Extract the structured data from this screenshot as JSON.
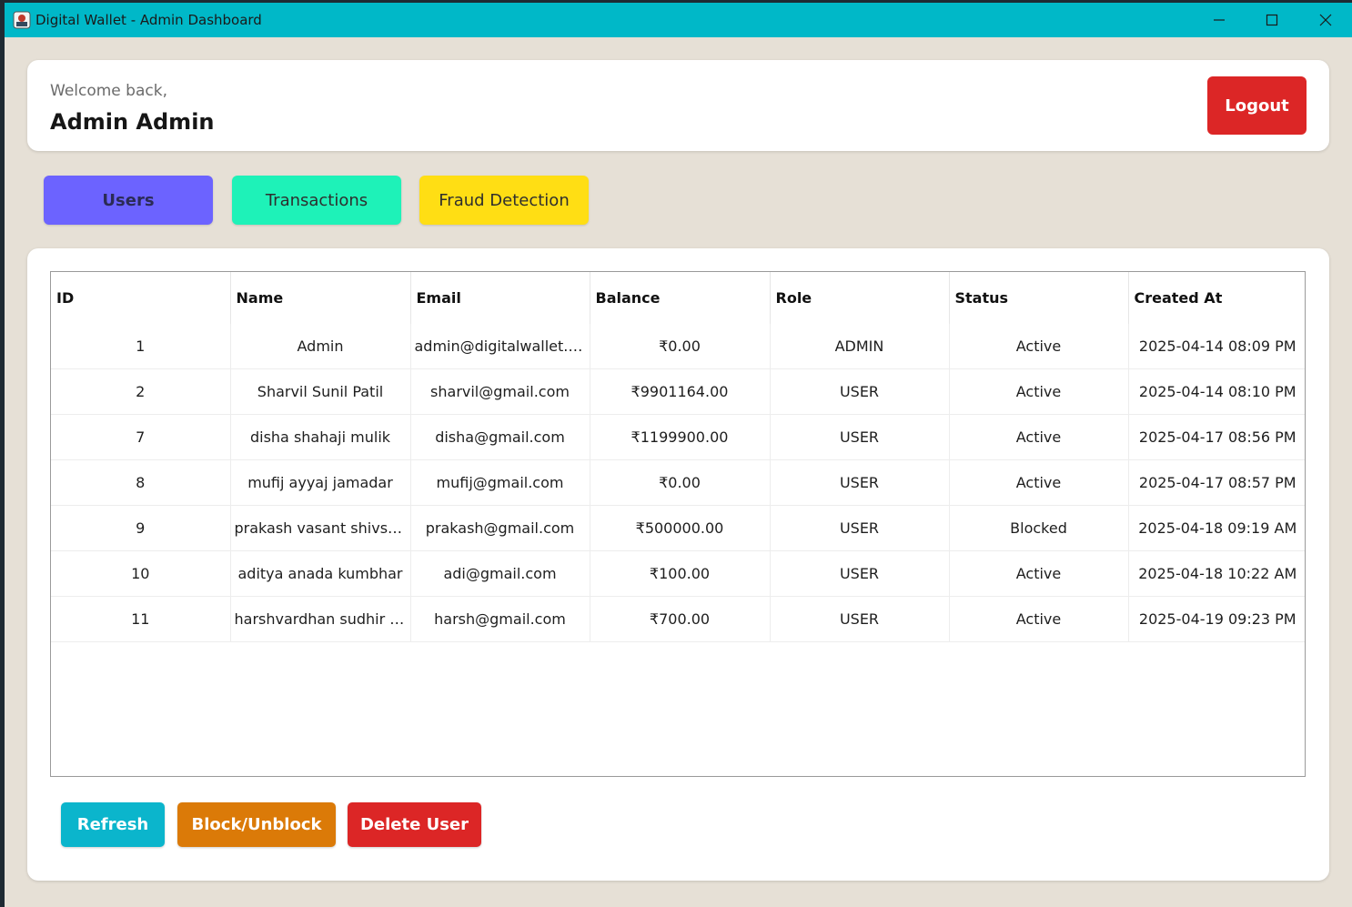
{
  "window": {
    "title": "Digital Wallet - Admin Dashboard",
    "icons": [
      "app-icon",
      "minimize-icon",
      "maximize-icon",
      "close-icon"
    ]
  },
  "header": {
    "welcome": "Welcome back,",
    "admin_name": "Admin Admin",
    "logout_label": "Logout"
  },
  "tabs": [
    {
      "label": "Users",
      "color": "#6c63ff"
    },
    {
      "label": "Transactions",
      "color": "#1ef2b8"
    },
    {
      "label": "Fraud Detection",
      "color": "#ffde14"
    }
  ],
  "table": {
    "columns": [
      "ID",
      "Name",
      "Email",
      "Balance",
      "Role",
      "Status",
      "Created At"
    ],
    "rows": [
      [
        "1",
        "Admin",
        "admin@digitalwallet.c...",
        "₹0.00",
        "ADMIN",
        "Active",
        "2025-04-14 08:09 PM"
      ],
      [
        "2",
        "Sharvil Sunil Patil",
        "sharvil@gmail.com",
        "₹9901164.00",
        "USER",
        "Active",
        "2025-04-14 08:10 PM"
      ],
      [
        "7",
        "disha shahaji mulik",
        "disha@gmail.com",
        "₹1199900.00",
        "USER",
        "Active",
        "2025-04-17 08:56 PM"
      ],
      [
        "8",
        "mufij ayyaj jamadar",
        "mufij@gmail.com",
        "₹0.00",
        "USER",
        "Active",
        "2025-04-17 08:57 PM"
      ],
      [
        "9",
        "prakash vasant shivsha...",
        "prakash@gmail.com",
        "₹500000.00",
        "USER",
        "Blocked",
        "2025-04-18 09:19 AM"
      ],
      [
        "10",
        "aditya anada kumbhar",
        "adi@gmail.com",
        "₹100.00",
        "USER",
        "Active",
        "2025-04-18 10:22 AM"
      ],
      [
        "11",
        "harshvardhan sudhir p...",
        "harsh@gmail.com",
        "₹700.00",
        "USER",
        "Active",
        "2025-04-19 09:23 PM"
      ]
    ]
  },
  "actions": {
    "refresh_label": "Refresh",
    "block_label": "Block/Unblock",
    "delete_label": "Delete User"
  },
  "colors": {
    "titlebar": "#00b8c8",
    "background": "#e6e0d6",
    "logout": "#dc2626",
    "refresh": "#0bb5cc",
    "block": "#db7a08",
    "delete": "#dc2626"
  }
}
